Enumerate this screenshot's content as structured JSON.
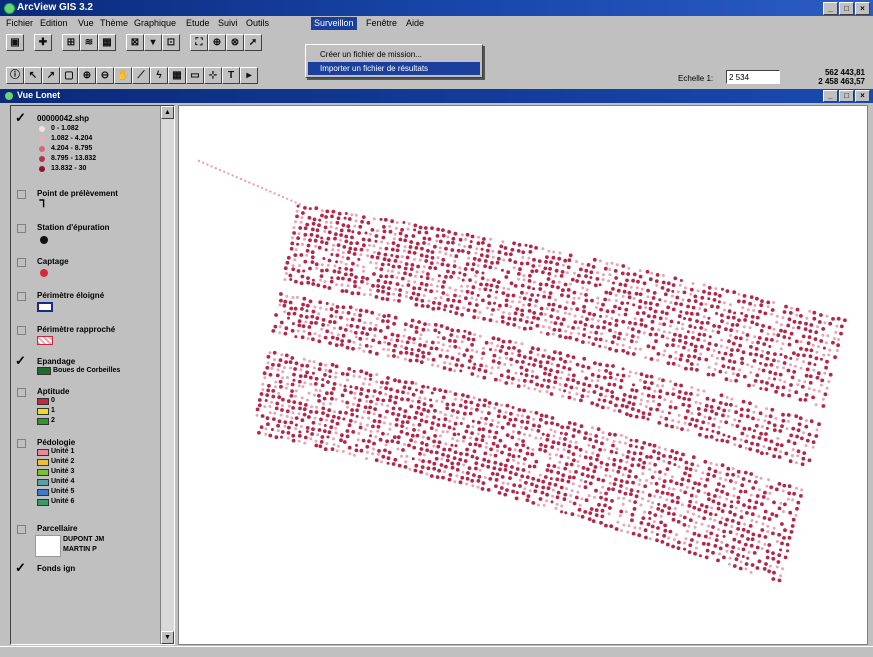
{
  "app": {
    "title": "ArcView GIS 3.2",
    "window_buttons": [
      "_",
      "□",
      "×"
    ]
  },
  "menu": {
    "items": [
      "Fichier",
      "Edition",
      "Vue",
      "Thème",
      "Graphique",
      "Etude",
      "Suivi",
      "Outils",
      "Surveillon",
      "Fenêtre",
      "Aide"
    ],
    "active_index": 8,
    "dropdown": [
      "Créer un fichier de mission...",
      "Importer un fichier de résultats"
    ],
    "dropdown_highlight_index": 1
  },
  "toolbar": {
    "scale_label": "Echelle 1:",
    "scale_value": "2 534",
    "coord_x": "562 443,81",
    "coord_y": "2 458 463,57"
  },
  "view": {
    "title": "Vue Lonet"
  },
  "toc": {
    "layers": [
      {
        "name": "00000042.shp",
        "checked": true,
        "legend": [
          {
            "label": "0 - 1.082",
            "color": "#f4dde3"
          },
          {
            "label": "1.082 - 4.204",
            "color": "#e8aebb"
          },
          {
            "label": "4.204 - 8.795",
            "color": "#d4667f"
          },
          {
            "label": "8.795 - 13.832",
            "color": "#b8324f"
          },
          {
            "label": "13.832 - 30",
            "color": "#8d1430"
          }
        ]
      },
      {
        "name": "Point de prélèvement",
        "checked": false
      },
      {
        "name": "Station d'épuration",
        "checked": false
      },
      {
        "name": "Captage",
        "checked": false
      },
      {
        "name": "Périmètre éloigné",
        "checked": false
      },
      {
        "name": "Périmètre rapproché",
        "checked": false
      },
      {
        "name": "Epandage",
        "checked": true,
        "legend": [
          {
            "label": "Boues de Corbeilles",
            "color": "#1f6b2a"
          }
        ]
      },
      {
        "name": "Aptitude",
        "checked": false,
        "legend": [
          {
            "label": "0",
            "color": "#c8283c"
          },
          {
            "label": "1",
            "color": "#e8e020"
          },
          {
            "label": "2",
            "color": "#2a9a2a"
          }
        ]
      },
      {
        "name": "Pédologie",
        "checked": false,
        "legend": [
          {
            "label": "Unité 1",
            "color": "#e88a9a"
          },
          {
            "label": "Unité 2",
            "color": "#e8c040"
          },
          {
            "label": "Unité 3",
            "color": "#7cbf3a"
          },
          {
            "label": "Unité 4",
            "color": "#5aa0a0"
          },
          {
            "label": "Unité 5",
            "color": "#4878c8"
          },
          {
            "label": "Unité 6",
            "color": "#3a9a6a"
          }
        ]
      },
      {
        "name": "Parcellaire",
        "checked": false,
        "legend": [
          {
            "label": "DUPONT JM"
          },
          {
            "label": "MARTIN P"
          }
        ]
      },
      {
        "name": "Fonds ign",
        "checked": true
      }
    ]
  },
  "colors": {
    "dot_dark": "#b5274a",
    "dot_light": "#e7a6b6",
    "title_bar": "#0a2a7a",
    "highlight": "#1a3f9c"
  },
  "icons": [
    "app-icon",
    "save-icon",
    "add-theme-icon",
    "zoom-in-icon",
    "zoom-out-icon",
    "pointer-icon",
    "identify-icon",
    "pan-icon",
    "text-tool-icon",
    "draw-tool-icon"
  ]
}
